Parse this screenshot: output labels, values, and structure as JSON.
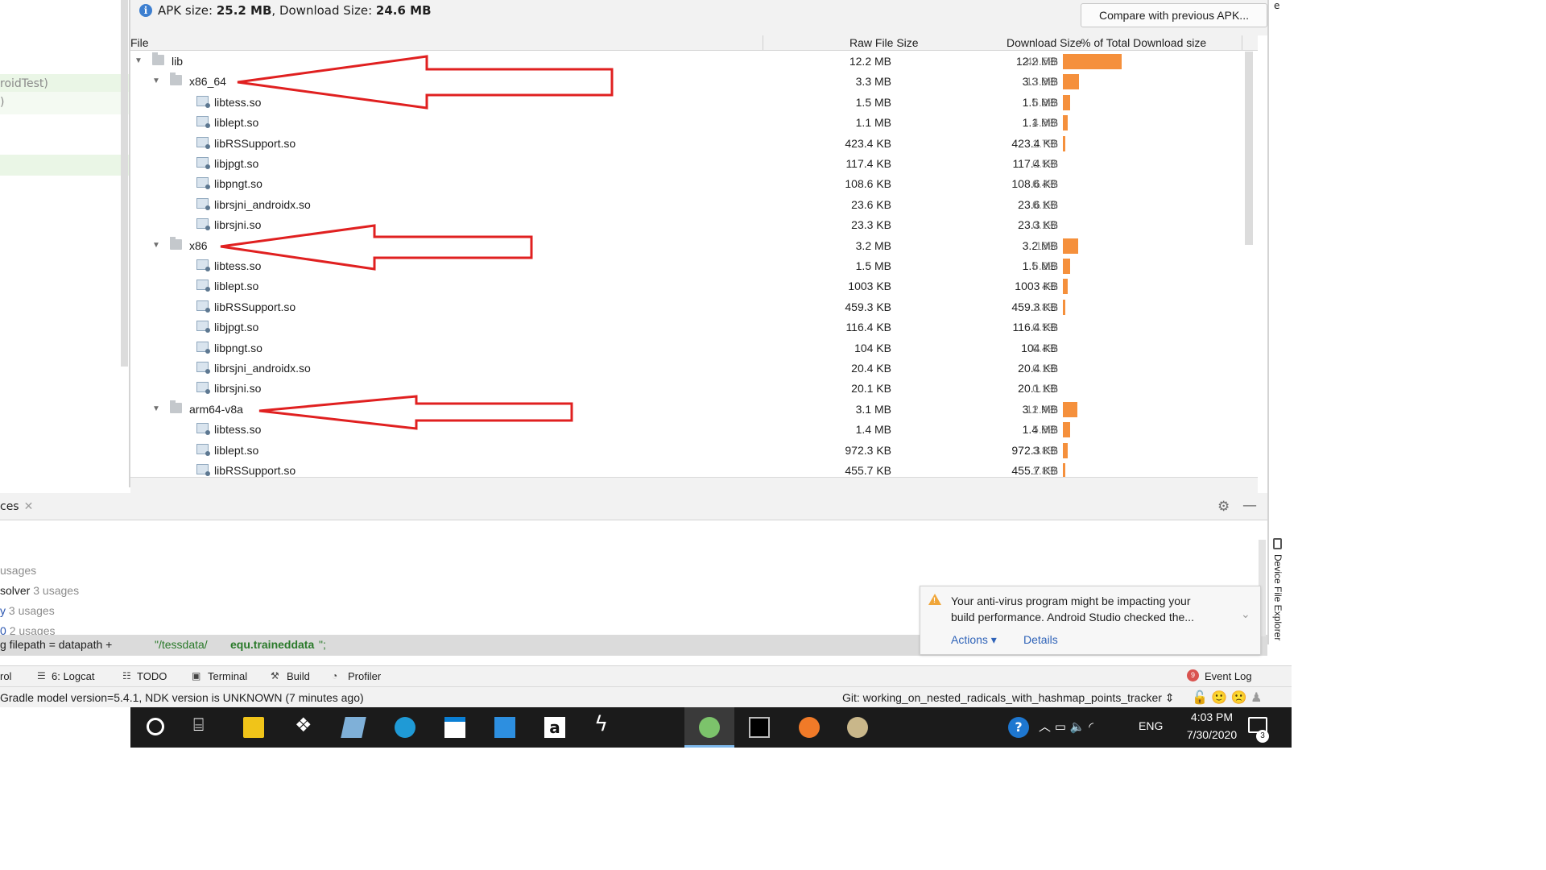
{
  "editor": {
    "lines": [
      {
        "text": "roidTest)"
      },
      {
        "text": ")"
      }
    ]
  },
  "apk": {
    "size_label": "APK size: ",
    "apk_size": "25.2 MB",
    "download_label": ", Download Size: ",
    "download_size": "24.6 MB",
    "compare_button": "Compare with previous APK...",
    "columns": {
      "file": "File",
      "raw": "Raw File Size",
      "download": "Download Size",
      "percent": "% of Total Download size"
    },
    "rows": [
      {
        "name": "lib",
        "type": "folder",
        "level": 0,
        "expanded": true,
        "raw": "12.2 MB",
        "download": "12.2 MB",
        "percent": "49.5%",
        "share": 0.495
      },
      {
        "name": "x86_64",
        "type": "folder",
        "level": 1,
        "expanded": true,
        "raw": "3.3 MB",
        "download": "3.3 MB",
        "percent": "13.3%",
        "share": 0.133
      },
      {
        "name": "libtess.so",
        "type": "file",
        "level": 2,
        "raw": "1.5 MB",
        "download": "1.5 MB",
        "percent": "6.2%",
        "share": 0.062
      },
      {
        "name": "liblept.so",
        "type": "file",
        "level": 2,
        "raw": "1.1 MB",
        "download": "1.1 MB",
        "percent": "4.3%",
        "share": 0.043
      },
      {
        "name": "libRSSupport.so",
        "type": "file",
        "level": 2,
        "raw": "423.4 KB",
        "download": "423.4 KB",
        "percent": "1.7%",
        "share": 0.017
      },
      {
        "name": "libjpgt.so",
        "type": "file",
        "level": 2,
        "raw": "117.4 KB",
        "download": "117.4 KB",
        "percent": "0.5%",
        "share": 0.0
      },
      {
        "name": "libpngt.so",
        "type": "file",
        "level": 2,
        "raw": "108.6 KB",
        "download": "108.6 KB",
        "percent": "0.4%",
        "share": 0.0
      },
      {
        "name": "librsjni_androidx.so",
        "type": "file",
        "level": 2,
        "raw": "23.6 KB",
        "download": "23.6 KB",
        "percent": "0.1%",
        "share": 0.0
      },
      {
        "name": "librsjni.so",
        "type": "file",
        "level": 2,
        "raw": "23.3 KB",
        "download": "23.3 KB",
        "percent": "0.1%",
        "share": 0.0
      },
      {
        "name": "x86",
        "type": "folder",
        "level": 1,
        "expanded": true,
        "raw": "3.2 MB",
        "download": "3.2 MB",
        "percent": "13%",
        "share": 0.13
      },
      {
        "name": "libtess.so",
        "type": "file",
        "level": 2,
        "raw": "1.5 MB",
        "download": "1.5 MB",
        "percent": "6.2%",
        "share": 0.062
      },
      {
        "name": "liblept.so",
        "type": "file",
        "level": 2,
        "raw": "1003 KB",
        "download": "1003 KB",
        "percent": "4%",
        "share": 0.04
      },
      {
        "name": "libRSSupport.so",
        "type": "file",
        "level": 2,
        "raw": "459.3 KB",
        "download": "459.3 KB",
        "percent": "1.8%",
        "share": 0.018
      },
      {
        "name": "libjpgt.so",
        "type": "file",
        "level": 2,
        "raw": "116.4 KB",
        "download": "116.4 KB",
        "percent": "0.5%",
        "share": 0.0
      },
      {
        "name": "libpngt.so",
        "type": "file",
        "level": 2,
        "raw": "104 KB",
        "download": "104 KB",
        "percent": "0.4%",
        "share": 0.0
      },
      {
        "name": "librsjni_androidx.so",
        "type": "file",
        "level": 2,
        "raw": "20.4 KB",
        "download": "20.4 KB",
        "percent": "0.1%",
        "share": 0.0
      },
      {
        "name": "librsjni.so",
        "type": "file",
        "level": 2,
        "raw": "20.1 KB",
        "download": "20.1 KB",
        "percent": "0.1%",
        "share": 0.0
      },
      {
        "name": "arm64-v8a",
        "type": "folder",
        "level": 1,
        "expanded": true,
        "raw": "3.1 MB",
        "download": "3.1 MB",
        "percent": "12.4%",
        "share": 0.124
      },
      {
        "name": "libtess.so",
        "type": "file",
        "level": 2,
        "raw": "1.4 MB",
        "download": "1.4 MB",
        "percent": "5.8%",
        "share": 0.058
      },
      {
        "name": "liblept.so",
        "type": "file",
        "level": 2,
        "raw": "972.3 KB",
        "download": "972.3 KB",
        "percent": "3.8%",
        "share": 0.038
      },
      {
        "name": "libRSSupport.so",
        "type": "file",
        "level": 2,
        "raw": "455.7 KB",
        "download": "455.7 KB",
        "percent": "1.8%",
        "share": 0.018
      }
    ],
    "bar_color": "#f5903c"
  },
  "usages": {
    "tab_label": "ces",
    "lines": [
      {
        "prefix": "",
        "text": "",
        "count": "usages"
      },
      {
        "prefix": "solver",
        "text": "",
        "count": "3 usages"
      },
      {
        "prefix": "y",
        "text": "",
        "count": "3 usages"
      },
      {
        "prefix": "0",
        "text": "",
        "count": "2 usages"
      }
    ],
    "code": {
      "part1": "g filepath = datapath + ",
      "part2": "\"/tessdata/",
      "part3": "equ.traineddata",
      "part4": "\";"
    }
  },
  "notification": {
    "line1": "Your anti-virus program might be impacting your",
    "line2": "build performance. Android Studio checked the...",
    "actions": "Actions ▾",
    "details": "Details"
  },
  "sidebar": {
    "device_explorer": "Device File Explorer",
    "top_char": "e"
  },
  "toolbar": {
    "items": [
      {
        "label": "rol"
      },
      {
        "label": "6: Logcat"
      },
      {
        "label": "TODO"
      },
      {
        "label": "Terminal"
      },
      {
        "label": "Build"
      },
      {
        "label": "Profiler"
      }
    ],
    "event_log": "Event Log",
    "event_count": "9"
  },
  "status": {
    "text": "Gradle model version=5.4.1, NDK version is UNKNOWN (7 minutes ago)",
    "git": "Git: working_on_nested_radicals_with_hashmap_points_tracker ⇕"
  },
  "taskbar": {
    "language": "ENG",
    "time": "4:03 PM",
    "date": "7/30/2020",
    "notification_count": "3",
    "help": "?"
  }
}
